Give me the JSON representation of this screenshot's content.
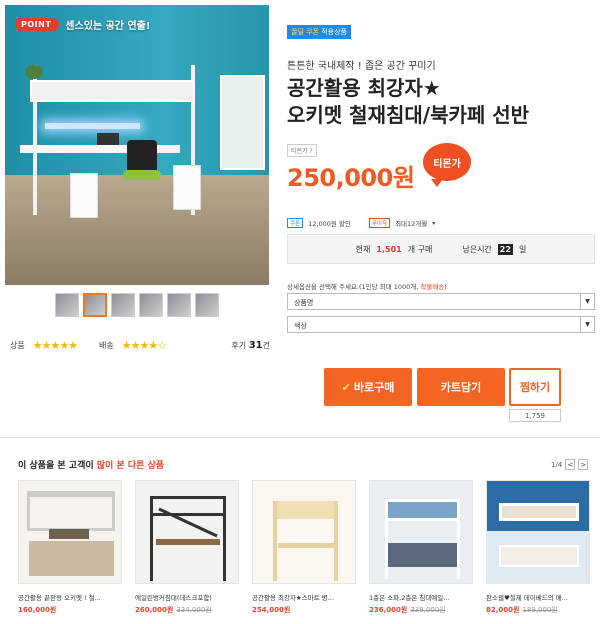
{
  "hero": {
    "point_tag": "POINT",
    "point_text": "센스있는 공간 연출!"
  },
  "ratings": {
    "product_label": "상품",
    "product_stars": "★★★★★",
    "delivery_label": "배송",
    "delivery_stars": "★★★★☆",
    "review_label": "후기",
    "review_count": "31",
    "review_unit": "건"
  },
  "product": {
    "coupon_a": "꿀딜 쿠폰",
    "coupon_b": "적용상품",
    "subtitle": "튼튼한 국내제작 ! 좁은 공간 꾸미기",
    "title_line1": "공간활용 최강자★",
    "title_line2": "오키멧 철재침대/북카페 선반",
    "tmon_price_label": "티몬가",
    "tmon_price_icon": "?",
    "price": "250,000원",
    "badge": "티몬가"
  },
  "info": {
    "coupon_chip": "쿠폰",
    "coupon_text": "12,000원 할인",
    "installment_chip": "무이자",
    "installment_text": "최대12개월"
  },
  "stats": {
    "current_label": "현재",
    "buy_count": "1,501",
    "buy_label": "개 구매",
    "remain_label": "남은시간",
    "remain_value": "22",
    "remain_unit": "일"
  },
  "options": {
    "guide": "상세옵션을 선택해 주세요.(1인당 최대 1000개,",
    "guide_hl": "착불배송",
    "guide_end": ")",
    "select1": "상품명",
    "select2": "색상"
  },
  "buttons": {
    "buy": "바로구매",
    "cart": "카트담기",
    "wish": "찜하기",
    "wish_count": "1,759"
  },
  "recommend": {
    "title_a": "이 상품을 본 고객이",
    "title_b": "많이 본 다른 상품",
    "page": "1/4",
    "prev": "<",
    "next": ">",
    "items": [
      {
        "name": "공간활용 끝판왕 오키멧 ! 철...",
        "price": "160,000원",
        "old": ""
      },
      {
        "name": "에일린벙커침대(데스크포함)",
        "price": "260,000원",
        "old": "334,000원"
      },
      {
        "name": "공간활용 최강자★스마트 병...",
        "price": "254,000원",
        "old": ""
      },
      {
        "name": "1층은 소파,2층은 침대예일...",
        "price": "236,000원",
        "old": "339,000원"
      },
      {
        "name": "판소웹♥철제 데이베드의 매...",
        "price": "82,000원",
        "old": "189,000원"
      }
    ]
  },
  "colors": {
    "accent": "#f26522",
    "price": "#f15a24",
    "blue": "#1a8cf0"
  }
}
